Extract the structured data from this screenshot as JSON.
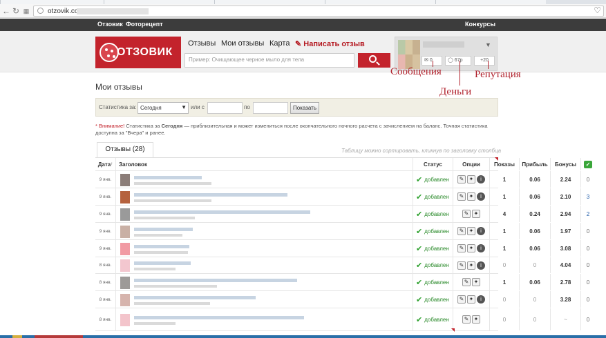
{
  "browser": {
    "url": "otzovik.com"
  },
  "topnav": {
    "otzovik": "Отзовик",
    "photorecipe": "Фоторецепт",
    "contests": "Конкурсы"
  },
  "header": {
    "logo_text": "ОТЗОВИК",
    "nav": [
      "Отзывы",
      "Мои отзывы",
      "Карта"
    ],
    "write_review": "Написать отзыв",
    "search_placeholder": "Пример: Очищающее черное мыло для тела",
    "messages_count": "0",
    "money": "67р",
    "reputation": "+20"
  },
  "annotations": {
    "messages": "Сообщения",
    "money": "Деньги",
    "reputation": "Репутация"
  },
  "page": {
    "title": "Мои отзывы"
  },
  "stats": {
    "label": "Статистика за:",
    "period_selected": "Сегодня",
    "or_from": "или с",
    "to": "по",
    "show_button": "Показать"
  },
  "note": {
    "warning": "Внимание!",
    "text1": " Статистика за ",
    "bold_today": "Сегодня",
    "text2": " — приблизительная и может измениться после окончательного ночного расчета с зачислением на баланс. Точная статистика доступна за \"Вчера\" и ранее."
  },
  "tab": {
    "label": "Отзывы (28)"
  },
  "sort_hint": "Таблицу можно сортировать, кликнув по заголовку столбца",
  "columns": {
    "date": "Дата",
    "title": "Заголовок",
    "status": "Статус",
    "options": "Опции",
    "shows": "Показы",
    "profit": "Прибыль",
    "bonus": "Бонусы"
  },
  "rows": [
    {
      "date": "9 янв.",
      "status": "добавлен",
      "shows": "1",
      "profit": "0.06",
      "bonus": "2.24",
      "likes": "0"
    },
    {
      "date": "9 янв.",
      "status": "добавлен",
      "shows": "1",
      "profit": "0.06",
      "bonus": "2.10",
      "likes": "3"
    },
    {
      "date": "9 янв.",
      "status": "добавлен",
      "shows": "4",
      "profit": "0.24",
      "bonus": "2.94",
      "likes": "2"
    },
    {
      "date": "9 янв.",
      "status": "добавлен",
      "shows": "1",
      "profit": "0.06",
      "bonus": "1.97",
      "likes": "0"
    },
    {
      "date": "9 янв.",
      "status": "добавлен",
      "shows": "1",
      "profit": "0.06",
      "bonus": "3.08",
      "likes": "0"
    },
    {
      "date": "8 янв.",
      "status": "добавлен",
      "shows": "0",
      "profit": "0",
      "bonus": "4.04",
      "likes": "0"
    },
    {
      "date": "8 янв.",
      "status": "добавлен",
      "shows": "1",
      "profit": "0.06",
      "bonus": "2.78",
      "likes": "0"
    },
    {
      "date": "8 янв.",
      "status": "добавлен",
      "shows": "0",
      "profit": "0",
      "bonus": "3.28",
      "likes": "0"
    },
    {
      "date": "8 янв.",
      "status": "добавлен",
      "shows": "0",
      "profit": "0",
      "bonus": "~",
      "likes": "0"
    }
  ]
}
